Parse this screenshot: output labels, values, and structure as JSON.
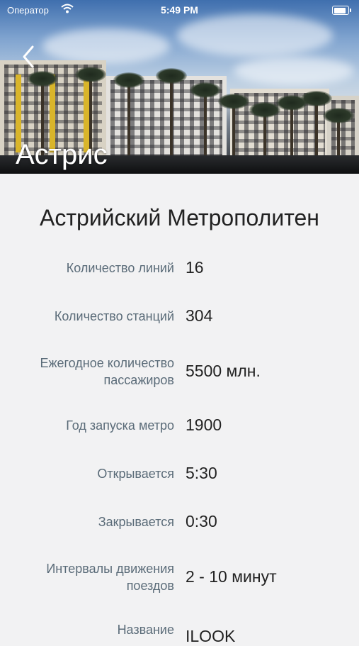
{
  "status_bar": {
    "carrier": "Оператор",
    "time": "5:49 PM",
    "battery_level": 1.0
  },
  "header": {
    "back_icon": "chevron-left-icon",
    "city": "Астрис"
  },
  "metro": {
    "title": "Астрийский Метрополитен",
    "rows": [
      {
        "label": "Количество линий",
        "value": "16"
      },
      {
        "label": "Количество станций",
        "value": "304"
      },
      {
        "label": "Ежегодное количество\nпассажиров",
        "value": "5500 млн."
      },
      {
        "label": "Год запуска метро",
        "value": "1900"
      },
      {
        "label": "Открывается",
        "value": "5:30"
      },
      {
        "label": "Закрывается",
        "value": "0:30"
      },
      {
        "label": "Интервалы движения\nпоездов",
        "value": "2 - 10 минут"
      },
      {
        "label": "Название",
        "value": "ILOOK"
      }
    ]
  }
}
